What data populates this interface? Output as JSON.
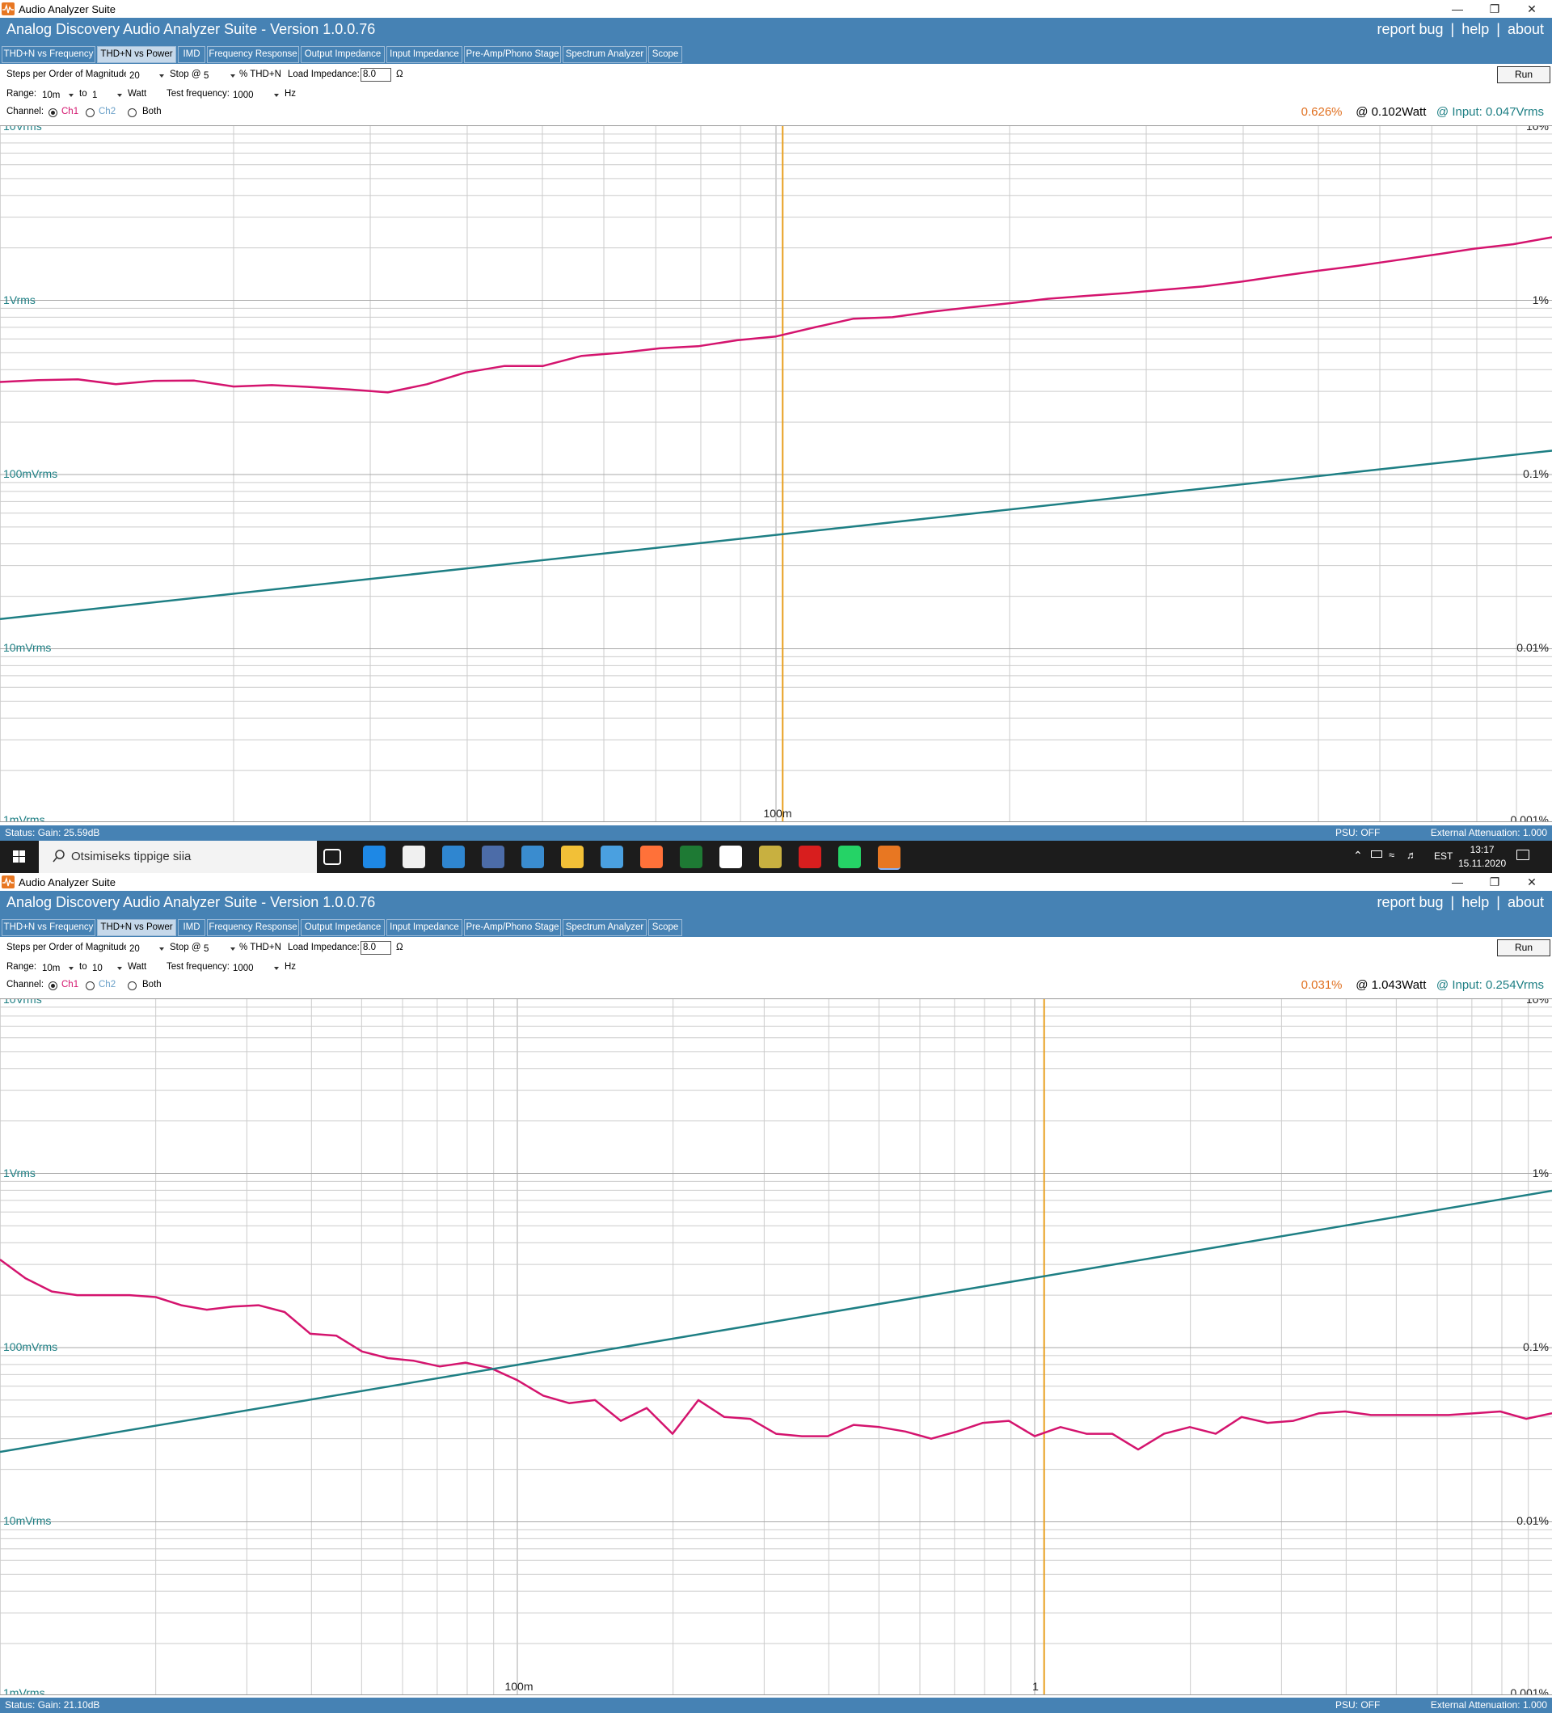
{
  "window_title": "Audio Analyzer Suite",
  "app_title": "Analog Discovery Audio Analyzer Suite - Version   1.0.0.76",
  "header_links": [
    "report bug",
    "help",
    "about"
  ],
  "header_sep": "|",
  "window_controls": {
    "minimize": "—",
    "restore": "❐",
    "close": "✕"
  },
  "tabs": [
    "THD+N vs Frequency",
    "THD+N vs Power",
    "IMD",
    "Frequency Response",
    "Output Impedance",
    "Input Impedance",
    "Pre-Amp/Phono Stage",
    "Spectrum Analyzer",
    "Scope"
  ],
  "active_tab": "THD+N vs Power",
  "controls": {
    "steps_label": "Steps per Order of Magnitude:",
    "steps_value": "20",
    "stop_label": "Stop @",
    "stop_value": "5",
    "thd_label": "% THD+N",
    "load_label": "Load Impedance:",
    "load_value": "8.0",
    "ohm": "Ω",
    "range_label": "Range:",
    "to_label": "to",
    "watt_label": "Watt",
    "freq_label": "Test frequency:",
    "freq_value": "1000",
    "hz_label": "Hz",
    "channel_label": "Channel:",
    "ch1": "Ch1",
    "ch2": "Ch2",
    "both": "Both",
    "run": "Run"
  },
  "y_labels_left": [
    "10Vrms",
    "1Vrms",
    "100mVrms",
    "10mVrms",
    "1mVrms"
  ],
  "y_labels_right": [
    "10%",
    "1%",
    "0.1%",
    "0.01%",
    "0.001%"
  ],
  "colors": {
    "thd": "#d4146e",
    "input": "#1e7f84",
    "cursor": "#e8a020",
    "header": "#4682b4",
    "grid": "#cccccc"
  },
  "panels": [
    {
      "range_from": "10m",
      "range_to": "1",
      "readout": {
        "thd": "0.626%",
        "power": "@ 0.102Watt",
        "input": "@ Input: 0.047Vrms"
      },
      "status_gain": "Status: Gain: 25.59dB",
      "psu": "PSU: OFF",
      "attenuation": "External Attenuation: 1.000",
      "x_tick_labels": [
        {
          "text": "100m"
        }
      ],
      "chart_data": {
        "type": "line",
        "x_scale": "log",
        "xlim": [
          0.01,
          1
        ],
        "y_scale": "log",
        "ylim_left_vrms": [
          0.001,
          10
        ],
        "ylim_right_percent": [
          0.001,
          10
        ],
        "cursor_x": 0.102,
        "series": [
          {
            "name": "THD+N",
            "axis": "right_percent",
            "x": [
              0.01,
              0.0112,
              0.0126,
              0.0141,
              0.0158,
              0.0178,
              0.02,
              0.0224,
              0.0251,
              0.0282,
              0.0316,
              0.0355,
              0.0398,
              0.0447,
              0.0501,
              0.0562,
              0.0631,
              0.0708,
              0.0794,
              0.0891,
              0.1,
              0.1122,
              0.1259,
              0.1413,
              0.1585,
              0.1778,
              0.1995,
              0.2239,
              0.2512,
              0.2818,
              0.3162,
              0.3548,
              0.3981,
              0.4467,
              0.5012,
              0.5623,
              0.631,
              0.7079,
              0.7943,
              0.8913,
              1.0
            ],
            "y": [
              0.34,
              0.348,
              0.352,
              0.33,
              0.345,
              0.346,
              0.32,
              0.326,
              0.318,
              0.308,
              0.296,
              0.33,
              0.385,
              0.42,
              0.42,
              0.48,
              0.5,
              0.53,
              0.545,
              0.59,
              0.62,
              0.7,
              0.785,
              0.8,
              0.86,
              0.91,
              0.96,
              1.02,
              1.06,
              1.1,
              1.15,
              1.2,
              1.28,
              1.38,
              1.48,
              1.58,
              1.7,
              1.83,
              1.98,
              2.1,
              2.3
            ]
          },
          {
            "name": "Input",
            "axis": "left_vrms",
            "x": [
              0.01,
              1
            ],
            "y": [
              0.0148,
              0.137
            ]
          }
        ]
      }
    },
    {
      "range_from": "10m",
      "range_to": "10",
      "readout": {
        "thd": "0.031%",
        "power": "@ 1.043Watt",
        "input": "@ Input: 0.254Vrms"
      },
      "status_gain": "Status: Gain: 21.10dB",
      "psu": "PSU: OFF",
      "attenuation": "External Attenuation: 1.000",
      "x_tick_labels": [
        {
          "text": "100m"
        },
        {
          "text": "1"
        }
      ],
      "chart_data": {
        "type": "line",
        "x_scale": "log",
        "xlim": [
          0.01,
          10
        ],
        "y_scale": "log",
        "ylim_left_vrms": [
          0.001,
          10
        ],
        "ylim_right_percent": [
          0.001,
          10
        ],
        "cursor_x": 1.043,
        "series": [
          {
            "name": "THD+N",
            "axis": "right_percent",
            "x": [
              0.01,
              0.0112,
              0.0126,
              0.0141,
              0.0158,
              0.0178,
              0.02,
              0.0224,
              0.0251,
              0.0282,
              0.0316,
              0.0355,
              0.0398,
              0.0447,
              0.0501,
              0.0562,
              0.0631,
              0.0708,
              0.0794,
              0.0891,
              0.1,
              0.1122,
              0.1259,
              0.1413,
              0.1585,
              0.1778,
              0.1995,
              0.2239,
              0.2512,
              0.2818,
              0.3162,
              0.3548,
              0.3981,
              0.4467,
              0.5012,
              0.5623,
              0.631,
              0.7079,
              0.7943,
              0.8913,
              1.0,
              1.122,
              1.2589,
              1.4125,
              1.5849,
              1.7783,
              1.9953,
              2.2387,
              2.5119,
              2.8184,
              3.1623,
              3.5481,
              3.9811,
              4.4668,
              5.0119,
              5.6234,
              6.3096,
              7.0795,
              7.9433,
              8.9125,
              10.0
            ],
            "y": [
              0.32,
              0.25,
              0.21,
              0.2,
              0.2,
              0.2,
              0.195,
              0.175,
              0.165,
              0.172,
              0.175,
              0.16,
              0.12,
              0.117,
              0.095,
              0.087,
              0.084,
              0.078,
              0.082,
              0.076,
              0.065,
              0.053,
              0.048,
              0.05,
              0.038,
              0.045,
              0.032,
              0.05,
              0.04,
              0.039,
              0.032,
              0.031,
              0.031,
              0.036,
              0.035,
              0.033,
              0.03,
              0.033,
              0.037,
              0.038,
              0.031,
              0.035,
              0.032,
              0.032,
              0.026,
              0.032,
              0.035,
              0.032,
              0.04,
              0.037,
              0.038,
              0.042,
              0.043,
              0.041,
              0.041,
              0.041,
              0.041,
              0.042,
              0.043,
              0.039,
              0.042
            ]
          },
          {
            "name": "Input",
            "axis": "left_vrms",
            "x": [
              0.01,
              10
            ],
            "y": [
              0.0252,
              0.795
            ]
          }
        ]
      }
    }
  ],
  "taskbar": {
    "search_placeholder": "Otsimiseks tippige siia",
    "lang": "EST",
    "time": "13:17",
    "date": "15.11.2020",
    "icons": [
      "task-view-icon",
      "edge-icon",
      "store-icon",
      "mail-icon",
      "calculator-icon",
      "photos-icon",
      "file-explorer-icon",
      "paint-icon",
      "firefox-icon",
      "winamp-icon",
      "fox-icon",
      "spreadsheet-icon",
      "game-icon",
      "whatsapp-icon",
      "audio-analyzer-icon"
    ]
  }
}
